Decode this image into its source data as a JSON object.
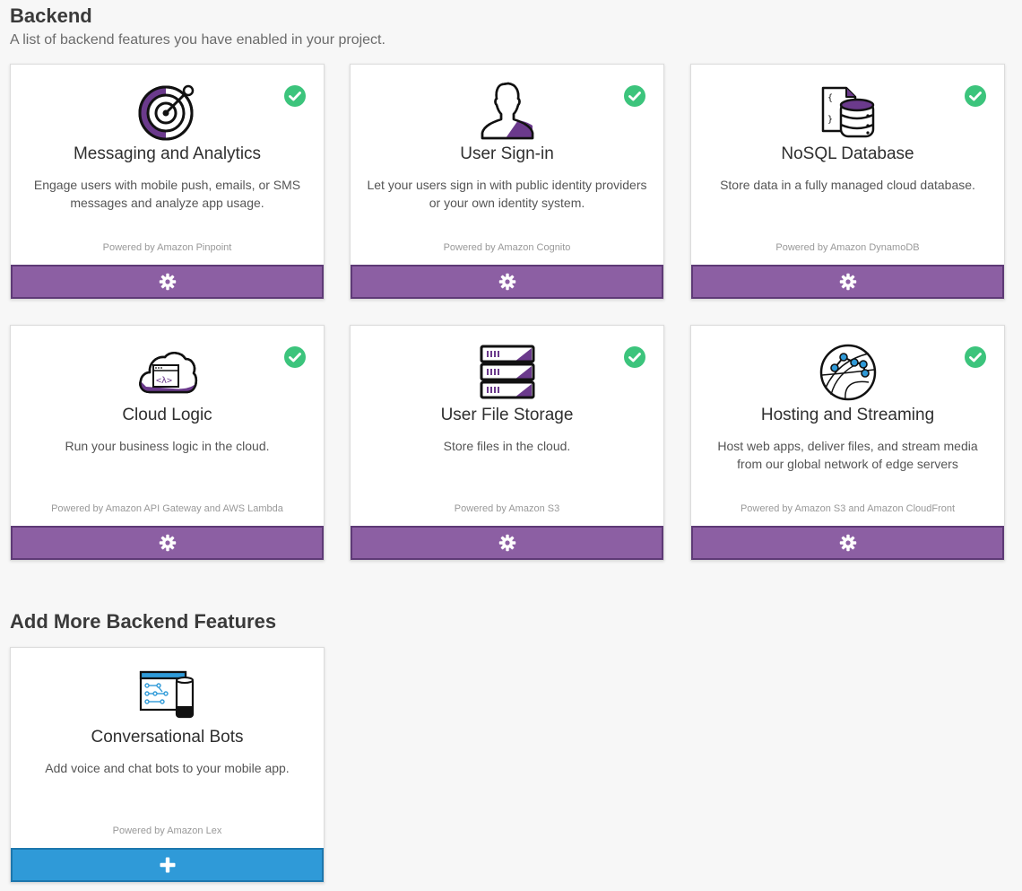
{
  "header": {
    "title": "Backend",
    "subtitle": "A list of backend features you have enabled in your project."
  },
  "features": [
    {
      "title": "Messaging and Analytics",
      "description": "Engage users with mobile push, emails, or SMS messages and analyze app usage.",
      "powered_by": "Powered by Amazon Pinpoint",
      "icon": "target-icon",
      "enabled": true
    },
    {
      "title": "User Sign-in",
      "description": "Let your users sign in with public identity providers or your own identity system.",
      "powered_by": "Powered by Amazon Cognito",
      "icon": "user-silhouette-icon",
      "enabled": true
    },
    {
      "title": "NoSQL Database",
      "description": "Store data in a fully managed cloud database.",
      "powered_by": "Powered by Amazon DynamoDB",
      "icon": "database-icon",
      "enabled": true
    },
    {
      "title": "Cloud Logic",
      "description": "Run your business logic in the cloud.",
      "powered_by": "Powered by Amazon API Gateway and AWS Lambda",
      "icon": "cloud-lambda-icon",
      "enabled": true
    },
    {
      "title": "User File Storage",
      "description": "Store files in the cloud.",
      "powered_by": "Powered by Amazon S3",
      "icon": "server-rack-icon",
      "enabled": true
    },
    {
      "title": "Hosting and Streaming",
      "description": "Host web apps, deliver files, and stream media from our global network of edge servers",
      "powered_by": "Powered by Amazon S3 and Amazon CloudFront",
      "icon": "globe-network-icon",
      "enabled": true
    }
  ],
  "add_more": {
    "title": "Add More Backend Features",
    "features": [
      {
        "title": "Conversational Bots",
        "description": "Add voice and chat bots to your mobile app.",
        "powered_by": "Powered by Amazon Lex",
        "icon": "bot-console-icon"
      }
    ]
  },
  "colors": {
    "configure_button": "#8c5fa3",
    "add_button": "#2f9ad8",
    "enabled_check": "#3cc47c",
    "accent_purple": "#6b3a8c"
  }
}
